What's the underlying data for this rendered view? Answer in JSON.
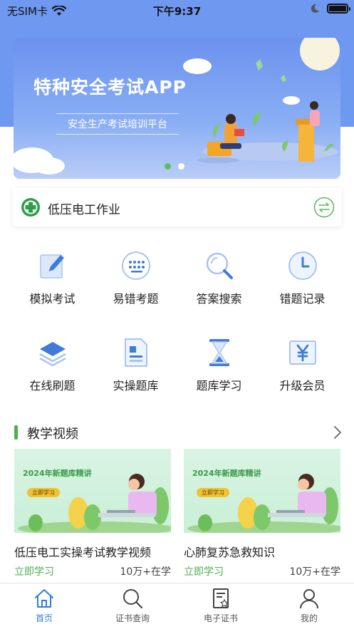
{
  "status_bar": {
    "carrier": "无SIM卡",
    "time": "下午9:37"
  },
  "banner": {
    "title": "特种安全考试APP",
    "subtitle": "安全生产考试培训平台",
    "slide_count": 2,
    "active_slide": 1
  },
  "subject": {
    "label": "低压电工作业",
    "logo_icon": "safety-cross-logo",
    "switch_icon": "swap-icon"
  },
  "grid": [
    {
      "label": "模拟考试",
      "icon": "edit-icon"
    },
    {
      "label": "易错考题",
      "icon": "dots-keypad-icon"
    },
    {
      "label": "答案搜索",
      "icon": "search-icon"
    },
    {
      "label": "错题记录",
      "icon": "clock-icon"
    },
    {
      "label": "在线刷题",
      "icon": "layers-icon"
    },
    {
      "label": "实操题库",
      "icon": "document-icon"
    },
    {
      "label": "题库学习",
      "icon": "hourglass-icon"
    },
    {
      "label": "升级会员",
      "icon": "yen-icon"
    }
  ],
  "videos": {
    "title": "教学视频",
    "items": [
      {
        "thumb_title": "2024年新题库精讲",
        "thumb_button": "立即学习",
        "title": "低压电工实操考试教学视频",
        "cta": "立即学习",
        "count": "10万+在学"
      },
      {
        "thumb_title": "2024年新题库精讲",
        "thumb_button": "立即学习",
        "title": "心肺复苏急救知识",
        "cta": "立即学习",
        "count": "10万+在学"
      }
    ]
  },
  "tabbar": [
    {
      "label": "首页",
      "icon": "home-icon",
      "active": true
    },
    {
      "label": "证书查询",
      "icon": "search-icon",
      "active": false
    },
    {
      "label": "电子证书",
      "icon": "certificate-icon",
      "active": false
    },
    {
      "label": "我的",
      "icon": "user-icon",
      "active": false
    }
  ],
  "colors": {
    "accent_blue": "#3f7bdc",
    "accent_green": "#4caf50",
    "banner_blue": "#6b92ee"
  }
}
